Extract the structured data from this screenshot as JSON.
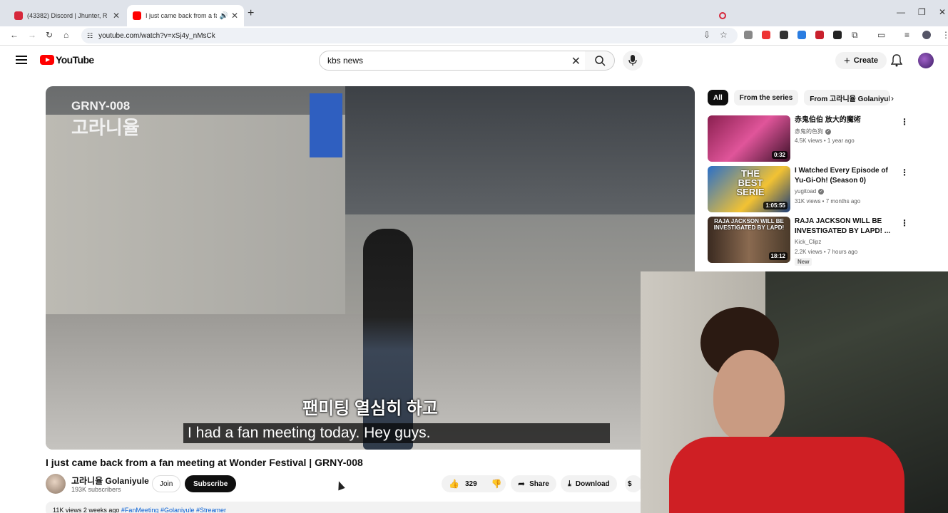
{
  "browser": {
    "tabs": [
      {
        "title": "(43382) Discord | Jhunter, R",
        "active": false
      },
      {
        "title": "I just came back from a fan",
        "active": true
      }
    ],
    "url": "youtube.com/watch?v=xSj4y_nMsCk"
  },
  "youtube": {
    "logo_text": "YouTube",
    "search_value": "kbs news",
    "create_label": "Create"
  },
  "video": {
    "watermark_code": "GRNY-008",
    "watermark_name": "고라니율",
    "subtitle_korean": "팬미팅 열심히 하고",
    "subtitle_english": "I had a fan meeting today.  Hey guys.",
    "title": "I just came back from a fan meeting at Wonder Festival | GRNY-008",
    "channel": "고라니율 Golaniyule",
    "subscribers": "193K subscribers",
    "join_label": "Join",
    "subscribe_label": "Subscribe",
    "likes": "329",
    "share_label": "Share",
    "download_label": "Download",
    "views_age": "11K views  2 weeks ago",
    "hashtags": "#FanMeeting #Golaniyule #Streamer"
  },
  "sidebar": {
    "chips": [
      "All",
      "From the series",
      "From 고라니율 Golaniyule"
    ],
    "recommendations": [
      {
        "title": "赤鬼伯伯 放大的魔術",
        "channel": "赤鬼的色狗",
        "verified": true,
        "meta": "4.5K views • 1 year ago",
        "duration": "0:32",
        "thumb_color": "#c03a6b"
      },
      {
        "title": "I Watched Every Episode of Yu-Gi-Oh! (Season 0)",
        "channel": "yugitoad",
        "verified": true,
        "meta": "31K views • 7 months ago",
        "duration": "1:05:55",
        "thumb_color": "#2a6fc9",
        "thumb_text": "THE BEST SERIE"
      },
      {
        "title": "RAJA JACKSON WILL BE INVESTIGATED BY LAPD! ...",
        "channel": "Kick_Clipz",
        "verified": false,
        "meta": "2.2K views • 7 hours ago",
        "duration": "18:12",
        "badge": "New",
        "thumb_color": "#5a4a3a",
        "thumb_text": "RAJA JACKSON WILL BE INVESTIGATED BY LAPD!"
      }
    ]
  },
  "colors": {
    "youtube_red": "#ff0000",
    "shirt_red": "#cf1f24",
    "link_blue": "#065fd4"
  }
}
